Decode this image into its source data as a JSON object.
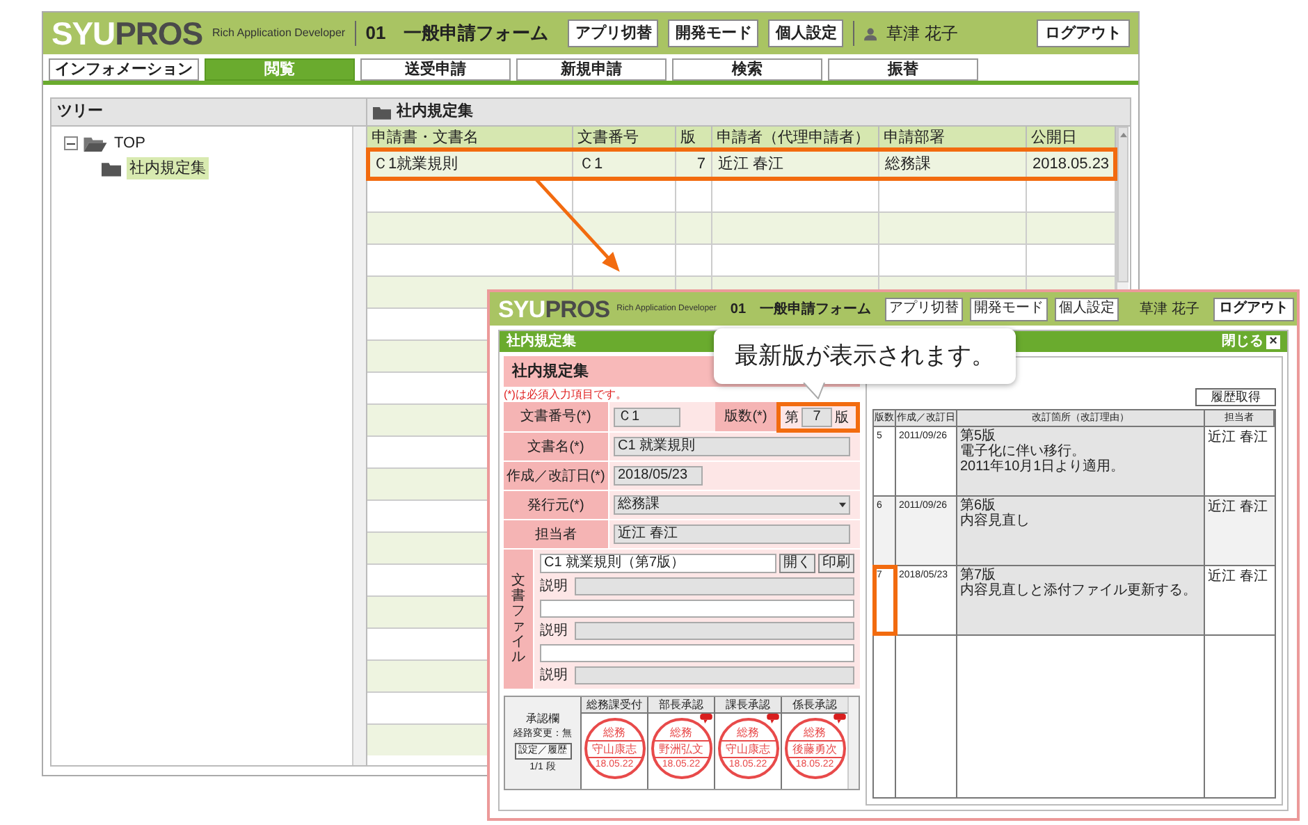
{
  "main_window": {
    "header": {
      "logo": [
        {
          "text": "SYU",
          "color": "#ffffff"
        },
        {
          "text": "PROS",
          "color": "#4a4a4a"
        }
      ],
      "tagline": "Rich Application Developer",
      "form_number": "01",
      "form_title": "一般申請フォーム",
      "buttons": [
        "アプリ切替",
        "開発モード",
        "個人設定"
      ],
      "user": "草津 花子",
      "logout": "ログアウト"
    },
    "tabs": [
      {
        "label": "インフォメーション",
        "selected": false
      },
      {
        "label": "閲覧",
        "selected": true
      },
      {
        "label": "送受申請",
        "selected": false
      },
      {
        "label": "新規申請",
        "selected": false
      },
      {
        "label": "検索",
        "selected": false
      },
      {
        "label": "振替",
        "selected": false
      }
    ],
    "tree": {
      "title": "ツリー",
      "items": [
        {
          "label": "TOP",
          "expanded": true,
          "children": [
            {
              "label": "社内規定集",
              "selected": true
            }
          ]
        }
      ]
    },
    "list": {
      "title": "社内規定集",
      "columns": [
        "申請書・文書名",
        "文書番号",
        "版",
        "申請者（代理申請者）",
        "申請部署",
        "公開日"
      ],
      "rows": [
        {
          "cells": [
            "Ｃ1就業規則",
            "Ｃ1",
            "7",
            "近江 春江",
            "総務課",
            "2018.05.23"
          ],
          "highlighted": true
        }
      ]
    }
  },
  "detail_window": {
    "header": {
      "logo": [
        {
          "text": "SYU",
          "color": "#ffffff"
        },
        {
          "text": "PROS",
          "color": "#4a4a4a"
        }
      ],
      "tagline": "Rich Application Developer",
      "form_number": "01",
      "form_title": "一般申請フォーム",
      "buttons": [
        "アプリ切替",
        "開発モード",
        "個人設定"
      ],
      "user": "草津 花子",
      "logout": "ログアウト"
    },
    "panel": {
      "title": "社内規定集",
      "close_label": "閉じる",
      "close_icon": "×"
    },
    "form": {
      "title": "社内規定集",
      "required_note": "(*)は必須入力項目です。",
      "doc_number": {
        "label": "文書番号(*)",
        "value": "Ｃ1"
      },
      "edition": {
        "label": "版数(*)",
        "prefix": "第",
        "value": "7",
        "suffix": "版",
        "highlighted": true
      },
      "fields": [
        {
          "label": "文書名(*)",
          "value": "C1 就業規則",
          "kind": "text"
        },
        {
          "label": "作成／改訂日(*)",
          "value": "2018/05/23",
          "kind": "date"
        },
        {
          "label": "発行元(*)",
          "value": "総務課",
          "kind": "select"
        },
        {
          "label": "担当者",
          "value": "近江 春江",
          "kind": "text"
        }
      ],
      "files": {
        "label": "文書ファイル",
        "file_name": "C1 就業規則（第7版）",
        "buttons": [
          "開く",
          "印刷"
        ],
        "entries": [
          {
            "kind": "description",
            "label": "説明"
          },
          {
            "kind": "file"
          },
          {
            "kind": "description",
            "label": "説明"
          },
          {
            "kind": "file"
          },
          {
            "kind": "description",
            "label": "説明"
          }
        ]
      },
      "approval": {
        "title": "承認欄",
        "route_change": "経路変更：無",
        "settings_button": "設定／履歴",
        "stage": "1/1 段",
        "stamps": [
          {
            "header": "総務課受付",
            "department": "総務",
            "name": "守山康志",
            "date": "18.05.22",
            "comment": false
          },
          {
            "header": "部長承認",
            "department": "総務",
            "name": "野洲弘文",
            "date": "18.05.22",
            "comment": true
          },
          {
            "header": "課長承認",
            "department": "総務",
            "name": "守山康志",
            "date": "18.05.22",
            "comment": true
          },
          {
            "header": "係長承認",
            "department": "総務",
            "name": "後藤勇次",
            "date": "18.05.22",
            "comment": true
          }
        ]
      }
    },
    "history": {
      "button": "履歴取得",
      "columns": [
        "版数",
        "作成／改訂日",
        "改訂箇所（改訂理由）",
        "担当者"
      ],
      "rows": [
        {
          "version": "5",
          "date": "2011/09/26",
          "reason": [
            "第5版",
            "電子化に伴い移行。",
            "2011年10月1日より適用。"
          ],
          "person": "近江 春江",
          "highlighted": false
        },
        {
          "version": "6",
          "date": "2011/09/26",
          "reason": [
            "第6版",
            "内容見直し"
          ],
          "person": "近江 春江",
          "highlighted": false
        },
        {
          "version": "7",
          "date": "2018/05/23",
          "reason": [
            "第7版",
            "内容見直しと添付ファイル更新する。"
          ],
          "person": "近江 春江",
          "highlighted": true
        }
      ]
    }
  },
  "callout": {
    "text": "最新版が表示されます。"
  }
}
